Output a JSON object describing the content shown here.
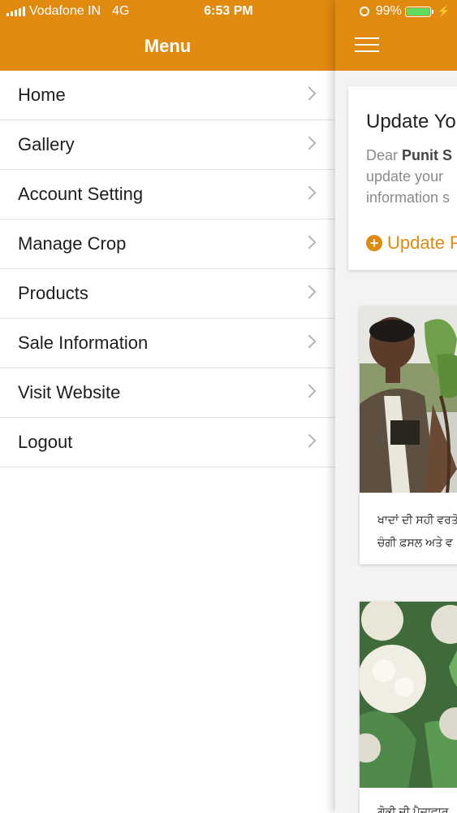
{
  "status_bar": {
    "carrier": "Vodafone IN",
    "network": "4G",
    "time": "6:53 PM",
    "battery": "99%",
    "battery_level": 0.99
  },
  "menu": {
    "title": "Menu",
    "items": [
      {
        "label": "Home"
      },
      {
        "label": "Gallery"
      },
      {
        "label": "Account Setting"
      },
      {
        "label": "Manage Crop"
      },
      {
        "label": "Products"
      },
      {
        "label": "Sale Information"
      },
      {
        "label": "Visit Website"
      },
      {
        "label": "Logout"
      }
    ]
  },
  "main": {
    "update_card": {
      "title": "Update Yo",
      "text_prefix": "Dear ",
      "text_name": "Punit S",
      "text_line2": "update your",
      "text_line3": "information s",
      "link": "Update P"
    },
    "posts": [
      {
        "line1": "ਖਾਦਾਂ ਦੀ ਸਹੀ ਵਰਤੋ",
        "line2": "ਚੰਗੀ ਫ਼ਸਲ ਅਤੇ ਵ"
      },
      {
        "line1": "ਗੋਭੀ ਦੀ ਪੈਦਾਵਾਰ",
        "line2": ""
      }
    ]
  },
  "colors": {
    "accent": "#e08a10",
    "battery_green": "#5fdc5f"
  }
}
